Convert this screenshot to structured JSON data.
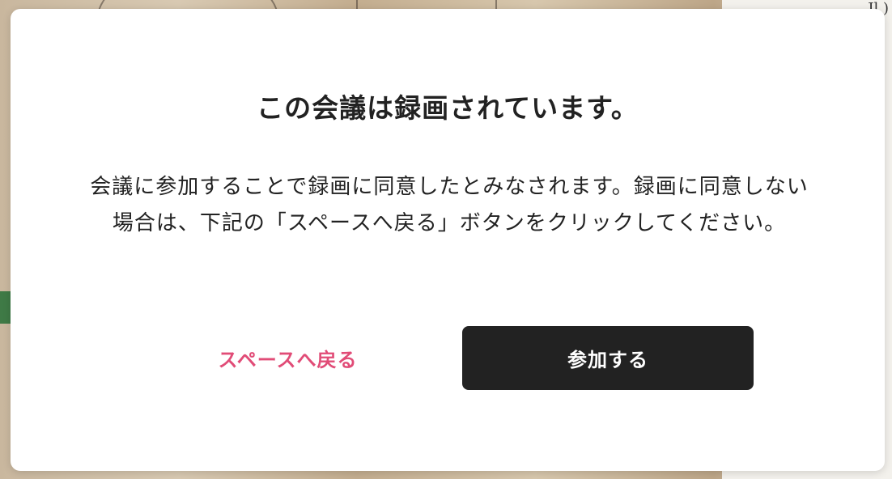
{
  "modal": {
    "title": "この会議は録画されています。",
    "message": "会議に参加することで録画に同意したとみなされます。録画に同意しない場合は、下記の「スペースへ戻る」ボタンをクリックしてください。",
    "back_label": "スペースへ戻る",
    "join_label": "参加する"
  },
  "background": {
    "corner_text": "Jl )"
  },
  "colors": {
    "accent_pink": "#e14c77",
    "primary_button": "#222222",
    "modal_bg": "#ffffff",
    "text": "#222222"
  }
}
